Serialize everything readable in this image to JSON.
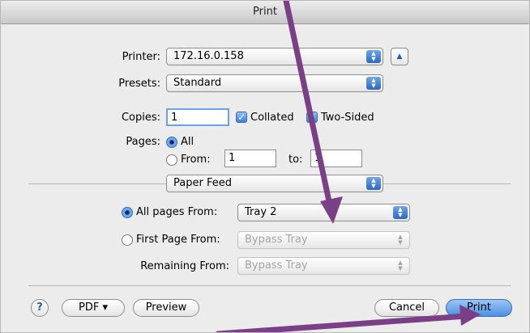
{
  "window": {
    "title": "Print"
  },
  "printer": {
    "label": "Printer:",
    "value": "172.16.0.158",
    "collapse_icon": "triangle-up-icon"
  },
  "presets": {
    "label": "Presets:",
    "value": "Standard"
  },
  "copies": {
    "label": "Copies:",
    "value": "1",
    "collated_label": "Collated",
    "collated_checked": true,
    "two_sided_label": "Two-Sided",
    "two_sided_checked": true
  },
  "pages": {
    "label": "Pages:",
    "all_label": "All",
    "from_label": "From:",
    "from_value": "1",
    "to_label": "to:",
    "to_value": "1"
  },
  "section": {
    "value": "Paper Feed"
  },
  "paper_feed": {
    "all_pages_label": "All pages From:",
    "all_pages_value": "Tray 2",
    "first_page_label": "First Page From:",
    "first_page_value": "Bypass Tray",
    "remaining_label": "Remaining From:",
    "remaining_value": "Bypass Tray"
  },
  "buttons": {
    "help": "?",
    "pdf": "PDF ▾",
    "preview": "Preview",
    "cancel": "Cancel",
    "print": "Print"
  },
  "colors": {
    "annotation_arrow": "#7a3f86",
    "accent": "#4a8ee2"
  },
  "icons": {
    "popup_arrows": "up-down-arrows-icon",
    "checkmark": "checkmark-icon"
  }
}
